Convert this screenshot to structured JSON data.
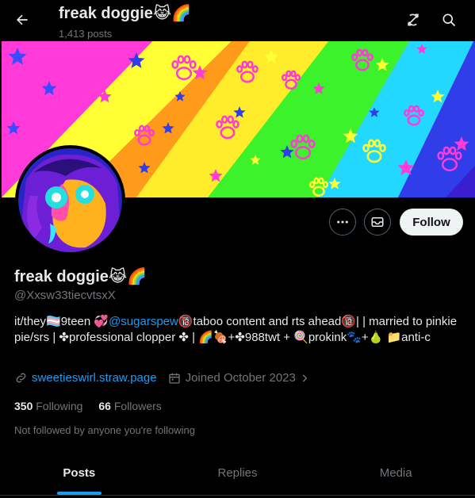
{
  "header": {
    "title": "freak doggie😹🌈",
    "post_count": "1,413 posts"
  },
  "profile": {
    "display_name": "freak doggie😹🌈",
    "handle": "@Xxsw33tiecvtsxX",
    "bio": {
      "part1": "it/they🏳️‍⚧️9teen 💞",
      "mention": "@sugarspew",
      "part2": "🔞taboo content and rts ahead🔞| | married to pinkie pie/srs | ✤professional clopper ✤ | 🌈🍖+✤988twt + 🍭prokink🐾+🍐 📁anti-c"
    },
    "website": "sweetieswirl.straw.page",
    "joined": "Joined October 2023",
    "following_count": "350",
    "following_label": "Following",
    "followers_count": "66",
    "followers_label": "Followers",
    "not_followed_text": "Not followed by anyone you're following"
  },
  "actions": {
    "follow_label": "Follow"
  },
  "tabs": [
    {
      "label": "Posts",
      "active": true
    },
    {
      "label": "Replies",
      "active": false
    },
    {
      "label": "Media",
      "active": false
    }
  ],
  "colors": {
    "accent": "#1d9bf0",
    "background": "#000000",
    "text_primary": "#e7e9ea",
    "text_secondary": "#71767b"
  },
  "icons": [
    "back-arrow-icon",
    "sync-icon",
    "search-icon",
    "more-icon",
    "mail-icon",
    "link-icon",
    "calendar-icon",
    "chevron-right-icon"
  ]
}
